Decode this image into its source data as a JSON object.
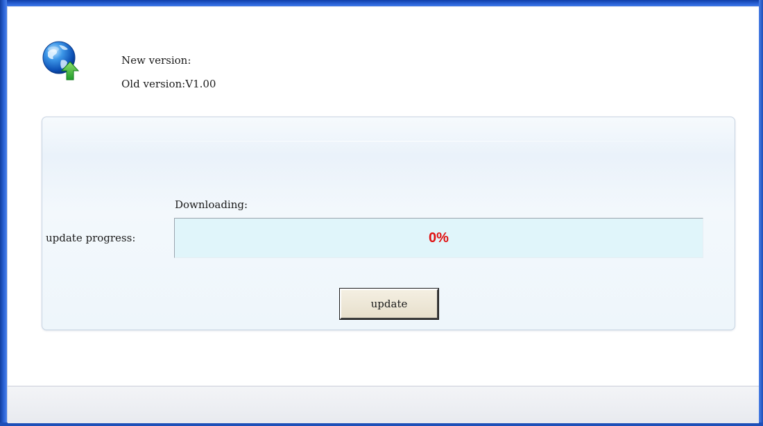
{
  "header": {
    "new_version_label": "New version:",
    "new_version_value": "",
    "old_version_label": "Old version:",
    "old_version_value": "V1.00",
    "icon": "globe-update-icon"
  },
  "panel": {
    "status_label": "Downloading:",
    "progress_label": "update progress:",
    "progress_value": 0,
    "progress_text": "0%",
    "update_button_label": "update"
  },
  "colors": {
    "progress_text": "#e01010",
    "progress_track": "#e0f5fa",
    "window_frame": "#2a62d6"
  }
}
